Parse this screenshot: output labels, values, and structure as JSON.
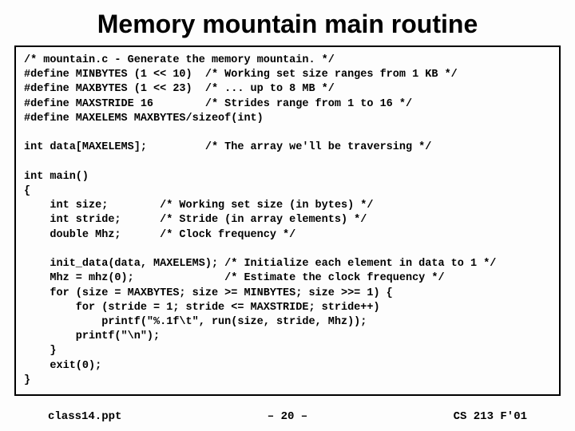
{
  "title": "Memory mountain main routine",
  "code": "/* mountain.c - Generate the memory mountain. */\n#define MINBYTES (1 << 10)  /* Working set size ranges from 1 KB */\n#define MAXBYTES (1 << 23)  /* ... up to 8 MB */\n#define MAXSTRIDE 16        /* Strides range from 1 to 16 */\n#define MAXELEMS MAXBYTES/sizeof(int)\n\nint data[MAXELEMS];         /* The array we'll be traversing */\n\nint main()\n{\n    int size;        /* Working set size (in bytes) */\n    int stride;      /* Stride (in array elements) */\n    double Mhz;      /* Clock frequency */\n\n    init_data(data, MAXELEMS); /* Initialize each element in data to 1 */\n    Mhz = mhz(0);              /* Estimate the clock frequency */\n    for (size = MAXBYTES; size >= MINBYTES; size >>= 1) {\n        for (stride = 1; stride <= MAXSTRIDE; stride++)\n            printf(\"%.1f\\t\", run(size, stride, Mhz));\n        printf(\"\\n\");\n    }\n    exit(0);\n}",
  "footer": {
    "left": "class14.ppt",
    "center": "– 20 –",
    "right": "CS 213 F'01"
  }
}
